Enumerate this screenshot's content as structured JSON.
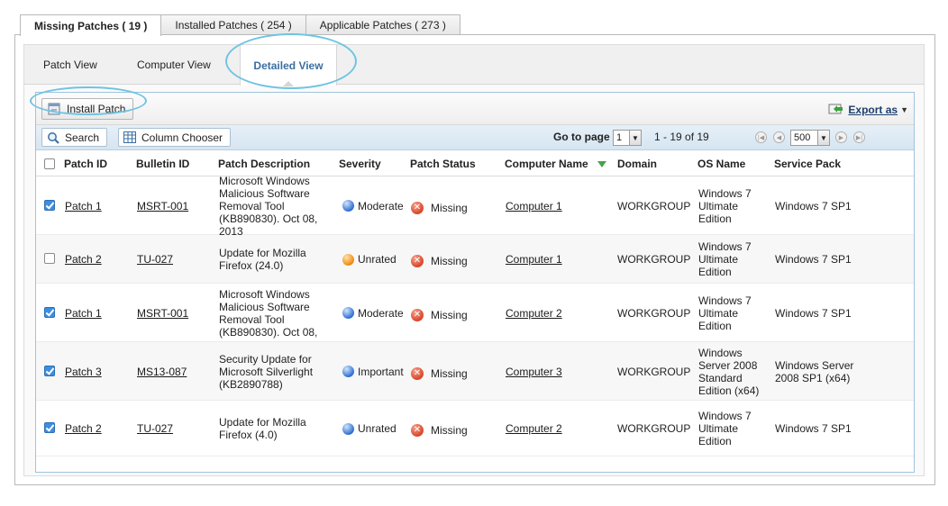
{
  "top_tabs": [
    {
      "label": "Missing Patches ( 19 )",
      "active": true
    },
    {
      "label": "Installed Patches ( 254 )",
      "active": false
    },
    {
      "label": "Applicable Patches ( 273 )",
      "active": false
    }
  ],
  "view_tabs": [
    {
      "label": "Patch View",
      "active": false
    },
    {
      "label": "Computer View",
      "active": false
    },
    {
      "label": "Detailed View",
      "active": true
    }
  ],
  "actions": {
    "install_label": "Install Patch",
    "export_label": "Export as"
  },
  "toolbar": {
    "search_label": "Search",
    "column_chooser_label": "Column Chooser",
    "goto_label": "Go to page",
    "page_value": "1",
    "range_text": "1 - 19 of 19",
    "per_page_value": "500"
  },
  "columns": [
    "Patch ID",
    "Bulletin ID",
    "Patch Description",
    "Severity",
    "Patch Status",
    "Computer Name",
    "Domain",
    "OS Name",
    "Service Pack"
  ],
  "sorted_column": "Computer Name",
  "rows": [
    {
      "checked": true,
      "patch_id": "Patch 1",
      "bulletin_id": "MSRT-001",
      "description": [
        "Microsoft Windows",
        "Malicious Software",
        "Removal Tool",
        "(KB890830). Oct 08,",
        "2013"
      ],
      "severity": "Moderate",
      "severity_color": "blue",
      "status": "Missing",
      "computer": "Computer 1",
      "domain": "WORKGROUP",
      "os": [
        "Windows 7",
        "Ultimate",
        "Edition"
      ],
      "service_pack": [
        "Windows 7 SP1"
      ]
    },
    {
      "checked": false,
      "patch_id": "Patch 2",
      "bulletin_id": "TU-027",
      "description": [
        "Update for Mozilla",
        "Firefox (24.0)"
      ],
      "severity": "Unrated",
      "severity_color": "orange",
      "status": "Missing",
      "computer": "Computer 1",
      "domain": "WORKGROUP",
      "os": [
        "Windows 7",
        "Ultimate",
        "Edition"
      ],
      "service_pack": [
        "Windows 7 SP1"
      ]
    },
    {
      "checked": true,
      "patch_id": "Patch 1",
      "bulletin_id": "MSRT-001",
      "description": [
        "Microsoft Windows",
        "Malicious Software",
        "Removal Tool",
        "(KB890830). Oct 08,"
      ],
      "severity": "Moderate",
      "severity_color": "blue",
      "status": "Missing",
      "computer": "Computer 2",
      "domain": "WORKGROUP",
      "os": [
        "Windows 7",
        "Ultimate",
        "Edition"
      ],
      "service_pack": [
        "Windows 7 SP1"
      ]
    },
    {
      "checked": true,
      "patch_id": "Patch 3",
      "bulletin_id": "MS13-087",
      "description": [
        "Security Update for",
        "Microsoft Silverlight",
        "(KB2890788)"
      ],
      "severity": "Important",
      "severity_color": "blue",
      "status": "Missing",
      "computer": "Computer 3",
      "domain": "WORKGROUP",
      "os": [
        "Windows",
        "Server 2008",
        "Standard",
        "Edition (x64)"
      ],
      "service_pack": [
        "Windows Server",
        "2008 SP1 (x64)"
      ]
    },
    {
      "checked": true,
      "patch_id": "Patch 2",
      "bulletin_id": "TU-027",
      "description": [
        "Update for Mozilla",
        "Firefox (4.0)"
      ],
      "severity": "Unrated",
      "severity_color": "blue",
      "status": "Missing",
      "computer": "Computer 2",
      "domain": "WORKGROUP",
      "os": [
        "Windows 7",
        "Ultimate",
        "Edition"
      ],
      "service_pack": [
        "Windows 7 SP1"
      ]
    }
  ],
  "colors": {
    "accent": "#3c6e9f",
    "callout": "#6fc3e3",
    "toolbar_bg": "#dce9f4",
    "missing": "#d8462a"
  }
}
